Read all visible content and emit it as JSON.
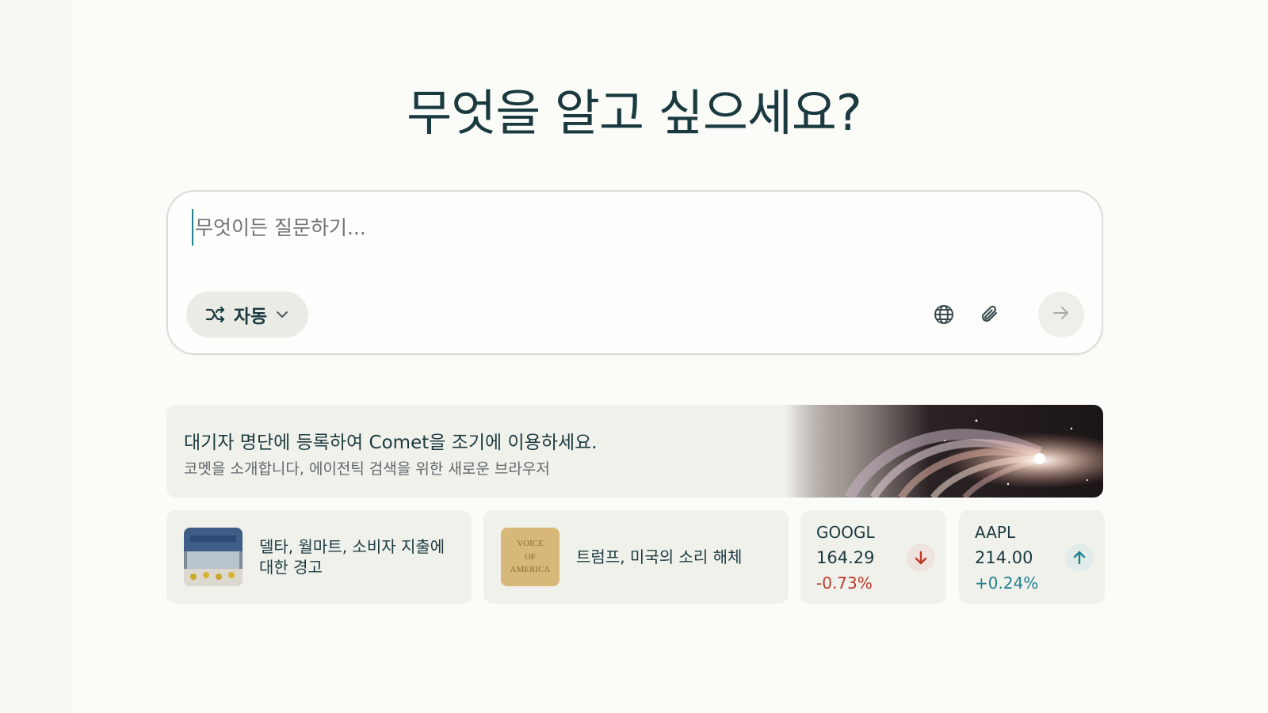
{
  "heading": "무엇을 알고 싶으세요?",
  "search": {
    "placeholder": "무엇이든 질문하기...",
    "value": "",
    "mode_label": "자동",
    "icons": [
      "shuffle-icon",
      "chevron-down-icon",
      "globe-icon",
      "paperclip-icon",
      "arrow-right-icon"
    ]
  },
  "promo": {
    "title": "대기자 명단에 등록하여 Comet을 조기에 이용하세요.",
    "subtitle": "코멧을 소개합니다, 에이전틱 검색을 위한 새로운 브라우저"
  },
  "news": [
    {
      "headline": "델타, 월마트, 소비자 지출에 대한 경고"
    },
    {
      "headline": "트럼프, 미국의 소리 해체",
      "thumb_text": [
        "VOICE",
        "OF",
        "AMERICA"
      ]
    }
  ],
  "stocks": [
    {
      "ticker": "GOOGL",
      "price": "164.29",
      "change": "-0.73%",
      "direction": "down",
      "color": "#c0392b"
    },
    {
      "ticker": "AAPL",
      "price": "214.00",
      "change": "+0.24%",
      "direction": "up",
      "color": "#20808d"
    }
  ]
}
